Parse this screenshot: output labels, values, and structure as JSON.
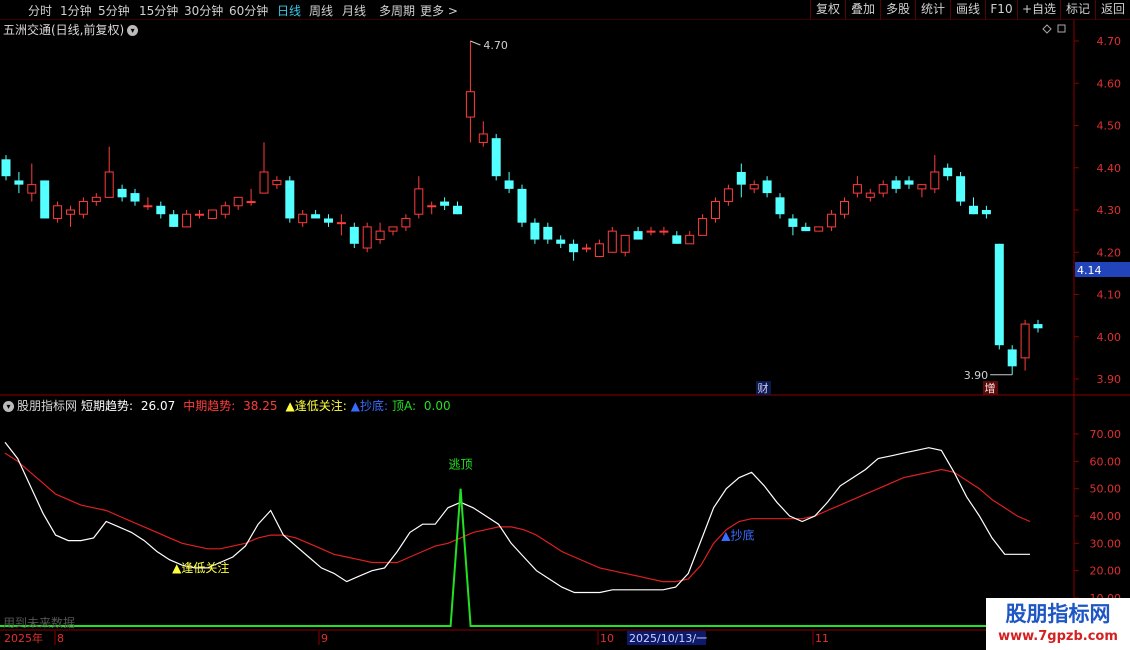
{
  "toolbar": {
    "periods": [
      "分时",
      "1分钟",
      "5分钟",
      "15分钟",
      "30分钟",
      "60分钟",
      "日线",
      "周线",
      "月线",
      "多周期",
      "更多"
    ],
    "active_period": "日线",
    "more_arrow": ">",
    "right_buttons": [
      "复权",
      "叠加",
      "多股",
      "统计",
      "画线",
      "F10",
      "+自选",
      "标记",
      "返回"
    ]
  },
  "main_chart": {
    "title": "五洲交通(日线,前复权)",
    "title_button_icon": "chevron-down-icon",
    "high_label": "4.70",
    "low_label": "3.90",
    "current_price": "4.14",
    "badge_cai": "财",
    "badge_zeng": "增",
    "price_ticks": [
      "4.70",
      "4.60",
      "4.50",
      "4.40",
      "4.30",
      "4.20",
      "4.10",
      "4.00",
      "3.90"
    ],
    "icons": [
      "diamond-icon",
      "square-icon"
    ]
  },
  "indicator": {
    "name": "股朋指标网",
    "short_label": "短期趋势:",
    "short_value": "26.07",
    "mid_label": "中期趋势:",
    "mid_value": "38.25",
    "low_focus_label": "▲逢低关注:",
    "bottom_label": "▲抄底:",
    "top_label": "顶A:",
    "top_value": "0.00",
    "ticks": [
      "70.00",
      "60.00",
      "50.00",
      "40.00",
      "30.00",
      "20.00",
      "10.00"
    ],
    "annotations": {
      "escape_top": "逃顶",
      "low_focus": "▲逢低关注",
      "buy_bottom": "▲抄底"
    },
    "future_note": "用到未来数据"
  },
  "date_axis": {
    "year": "2025年",
    "months": [
      "8",
      "9",
      "10",
      "11"
    ],
    "cursor_date": "2025/10/13/一"
  },
  "watermark": {
    "title": "股朋指标网",
    "url": "www.7gpzb.com"
  },
  "colors": {
    "up": "#ff3c3c",
    "down": "#54ffff",
    "short_line": "#ffffff",
    "mid_line": "#e02020",
    "signal_line": "#22e022",
    "axis": "#8b0000"
  },
  "chart_data": [
    {
      "type": "candlestick",
      "title": "五洲交通(日线,前复权)",
      "y_ticks": [
        3.9,
        4.0,
        4.1,
        4.2,
        4.3,
        4.4,
        4.5,
        4.6,
        4.7
      ],
      "ylim": [
        3.87,
        4.74
      ],
      "candles": [
        {
          "o": 4.42,
          "h": 4.43,
          "l": 4.37,
          "c": 4.38
        },
        {
          "o": 4.37,
          "h": 4.39,
          "l": 4.34,
          "c": 4.36
        },
        {
          "o": 4.34,
          "h": 4.41,
          "l": 4.32,
          "c": 4.36
        },
        {
          "o": 4.37,
          "h": 4.37,
          "l": 4.28,
          "c": 4.28
        },
        {
          "o": 4.28,
          "h": 4.32,
          "l": 4.27,
          "c": 4.31
        },
        {
          "o": 4.29,
          "h": 4.31,
          "l": 4.26,
          "c": 4.3
        },
        {
          "o": 4.29,
          "h": 4.33,
          "l": 4.28,
          "c": 4.32
        },
        {
          "o": 4.32,
          "h": 4.34,
          "l": 4.31,
          "c": 4.33
        },
        {
          "o": 4.33,
          "h": 4.45,
          "l": 4.33,
          "c": 4.39
        },
        {
          "o": 4.35,
          "h": 4.36,
          "l": 4.32,
          "c": 4.33
        },
        {
          "o": 4.34,
          "h": 4.35,
          "l": 4.31,
          "c": 4.32
        },
        {
          "o": 4.31,
          "h": 4.33,
          "l": 4.3,
          "c": 4.31
        },
        {
          "o": 4.31,
          "h": 4.32,
          "l": 4.28,
          "c": 4.29
        },
        {
          "o": 4.29,
          "h": 4.3,
          "l": 4.26,
          "c": 4.26
        },
        {
          "o": 4.26,
          "h": 4.3,
          "l": 4.26,
          "c": 4.29
        },
        {
          "o": 4.29,
          "h": 4.3,
          "l": 4.28,
          "c": 4.29
        },
        {
          "o": 4.28,
          "h": 4.3,
          "l": 4.28,
          "c": 4.3
        },
        {
          "o": 4.29,
          "h": 4.32,
          "l": 4.28,
          "c": 4.31
        },
        {
          "o": 4.31,
          "h": 4.33,
          "l": 4.3,
          "c": 4.33
        },
        {
          "o": 4.32,
          "h": 4.35,
          "l": 4.31,
          "c": 4.32
        },
        {
          "o": 4.34,
          "h": 4.46,
          "l": 4.34,
          "c": 4.39
        },
        {
          "o": 4.36,
          "h": 4.38,
          "l": 4.35,
          "c": 4.37
        },
        {
          "o": 4.37,
          "h": 4.38,
          "l": 4.27,
          "c": 4.28
        },
        {
          "o": 4.27,
          "h": 4.3,
          "l": 4.26,
          "c": 4.29
        },
        {
          "o": 4.29,
          "h": 4.3,
          "l": 4.28,
          "c": 4.28
        },
        {
          "o": 4.28,
          "h": 4.29,
          "l": 4.26,
          "c": 4.27
        },
        {
          "o": 4.27,
          "h": 4.29,
          "l": 4.24,
          "c": 4.27
        },
        {
          "o": 4.26,
          "h": 4.27,
          "l": 4.21,
          "c": 4.22
        },
        {
          "o": 4.21,
          "h": 4.27,
          "l": 4.2,
          "c": 4.26
        },
        {
          "o": 4.23,
          "h": 4.27,
          "l": 4.22,
          "c": 4.25
        },
        {
          "o": 4.25,
          "h": 4.26,
          "l": 4.24,
          "c": 4.26
        },
        {
          "o": 4.26,
          "h": 4.29,
          "l": 4.25,
          "c": 4.28
        },
        {
          "o": 4.29,
          "h": 4.38,
          "l": 4.28,
          "c": 4.35
        },
        {
          "o": 4.31,
          "h": 4.32,
          "l": 4.29,
          "c": 4.31
        },
        {
          "o": 4.32,
          "h": 4.33,
          "l": 4.3,
          "c": 4.31
        },
        {
          "o": 4.31,
          "h": 4.32,
          "l": 4.29,
          "c": 4.29
        },
        {
          "o": 4.52,
          "h": 4.7,
          "l": 4.46,
          "c": 4.58
        },
        {
          "o": 4.46,
          "h": 4.51,
          "l": 4.45,
          "c": 4.48
        },
        {
          "o": 4.47,
          "h": 4.48,
          "l": 4.37,
          "c": 4.38
        },
        {
          "o": 4.37,
          "h": 4.39,
          "l": 4.34,
          "c": 4.35
        },
        {
          "o": 4.35,
          "h": 4.36,
          "l": 4.26,
          "c": 4.27
        },
        {
          "o": 4.27,
          "h": 4.28,
          "l": 4.22,
          "c": 4.23
        },
        {
          "o": 4.26,
          "h": 4.27,
          "l": 4.22,
          "c": 4.23
        },
        {
          "o": 4.23,
          "h": 4.24,
          "l": 4.21,
          "c": 4.22
        },
        {
          "o": 4.22,
          "h": 4.23,
          "l": 4.18,
          "c": 4.2
        },
        {
          "o": 4.21,
          "h": 4.22,
          "l": 4.2,
          "c": 4.21
        },
        {
          "o": 4.19,
          "h": 4.23,
          "l": 4.19,
          "c": 4.22
        },
        {
          "o": 4.2,
          "h": 4.26,
          "l": 4.2,
          "c": 4.25
        },
        {
          "o": 4.2,
          "h": 4.24,
          "l": 4.19,
          "c": 4.24
        },
        {
          "o": 4.25,
          "h": 4.26,
          "l": 4.23,
          "c": 4.23
        },
        {
          "o": 4.25,
          "h": 4.26,
          "l": 4.24,
          "c": 4.25
        },
        {
          "o": 4.25,
          "h": 4.26,
          "l": 4.24,
          "c": 4.25
        },
        {
          "o": 4.24,
          "h": 4.25,
          "l": 4.22,
          "c": 4.22
        },
        {
          "o": 4.22,
          "h": 4.25,
          "l": 4.22,
          "c": 4.24
        },
        {
          "o": 4.24,
          "h": 4.29,
          "l": 4.24,
          "c": 4.28
        },
        {
          "o": 4.28,
          "h": 4.33,
          "l": 4.27,
          "c": 4.32
        },
        {
          "o": 4.32,
          "h": 4.36,
          "l": 4.31,
          "c": 4.35
        },
        {
          "o": 4.39,
          "h": 4.41,
          "l": 4.33,
          "c": 4.36
        },
        {
          "o": 4.35,
          "h": 4.37,
          "l": 4.34,
          "c": 4.36
        },
        {
          "o": 4.37,
          "h": 4.38,
          "l": 4.33,
          "c": 4.34
        },
        {
          "o": 4.33,
          "h": 4.34,
          "l": 4.28,
          "c": 4.29
        },
        {
          "o": 4.28,
          "h": 4.29,
          "l": 4.24,
          "c": 4.26
        },
        {
          "o": 4.26,
          "h": 4.27,
          "l": 4.25,
          "c": 4.25
        },
        {
          "o": 4.25,
          "h": 4.26,
          "l": 4.25,
          "c": 4.26
        },
        {
          "o": 4.26,
          "h": 4.3,
          "l": 4.25,
          "c": 4.29
        },
        {
          "o": 4.29,
          "h": 4.33,
          "l": 4.28,
          "c": 4.32
        },
        {
          "o": 4.34,
          "h": 4.38,
          "l": 4.33,
          "c": 4.36
        },
        {
          "o": 4.33,
          "h": 4.35,
          "l": 4.32,
          "c": 4.34
        },
        {
          "o": 4.34,
          "h": 4.37,
          "l": 4.33,
          "c": 4.36
        },
        {
          "o": 4.37,
          "h": 4.38,
          "l": 4.34,
          "c": 4.35
        },
        {
          "o": 4.37,
          "h": 4.38,
          "l": 4.35,
          "c": 4.36
        },
        {
          "o": 4.35,
          "h": 4.36,
          "l": 4.33,
          "c": 4.36
        },
        {
          "o": 4.35,
          "h": 4.43,
          "l": 4.34,
          "c": 4.39
        },
        {
          "o": 4.4,
          "h": 4.41,
          "l": 4.37,
          "c": 4.38
        },
        {
          "o": 4.38,
          "h": 4.39,
          "l": 4.31,
          "c": 4.32
        },
        {
          "o": 4.31,
          "h": 4.33,
          "l": 4.29,
          "c": 4.29
        },
        {
          "o": 4.3,
          "h": 4.31,
          "l": 4.28,
          "c": 4.29
        },
        {
          "o": 4.22,
          "h": 4.22,
          "l": 3.97,
          "c": 3.98
        },
        {
          "o": 3.97,
          "h": 3.98,
          "l": 3.91,
          "c": 3.93
        },
        {
          "o": 3.95,
          "h": 4.04,
          "l": 3.92,
          "c": 4.03
        },
        {
          "o": 4.03,
          "h": 4.04,
          "l": 4.01,
          "c": 4.02
        }
      ]
    },
    {
      "type": "line",
      "title": "股朋指标网",
      "ylim": [
        0,
        80
      ],
      "y_ticks": [
        10,
        20,
        30,
        40,
        50,
        60,
        70
      ],
      "series": [
        {
          "name": "短期趋势",
          "values": [
            67,
            61,
            51,
            41,
            33,
            31,
            31,
            32,
            38,
            36,
            34,
            31,
            27,
            24,
            22,
            21,
            21,
            23,
            25,
            29,
            37,
            42,
            33,
            29,
            25,
            21,
            19,
            16,
            18,
            20,
            21,
            27,
            34,
            37,
            37,
            43,
            45,
            43,
            40,
            37,
            30,
            25,
            20,
            17,
            14,
            12,
            12,
            12,
            13,
            13,
            13,
            13,
            13,
            14,
            19,
            31,
            43,
            50,
            54,
            56,
            51,
            45,
            40,
            38,
            40,
            45,
            51,
            54,
            57,
            61,
            62,
            63,
            64,
            65,
            64,
            56,
            47,
            40,
            32,
            26,
            26,
            26
          ]
        },
        {
          "name": "中期趋势",
          "values": [
            63,
            60,
            56,
            52,
            48,
            46,
            44,
            43,
            42,
            40,
            38,
            36,
            34,
            32,
            30,
            29,
            28,
            28,
            29,
            30,
            32,
            33,
            33,
            32,
            30,
            28,
            26,
            25,
            24,
            23,
            23,
            23,
            25,
            27,
            29,
            30,
            32,
            34,
            35,
            36,
            36,
            35,
            33,
            30,
            27,
            25,
            23,
            21,
            20,
            19,
            18,
            17,
            16,
            16,
            17,
            22,
            30,
            35,
            38,
            39,
            39,
            39,
            39,
            39,
            40,
            42,
            44,
            46,
            48,
            50,
            52,
            54,
            55,
            56,
            57,
            56,
            53,
            50,
            46,
            43,
            40,
            38
          ]
        },
        {
          "name": "顶A",
          "values": [
            0,
            0,
            0,
            0,
            0,
            0,
            0,
            0,
            0,
            0,
            0,
            0,
            0,
            0,
            0,
            0,
            0,
            0,
            0,
            0,
            0,
            0,
            0,
            0,
            0,
            0,
            0,
            0,
            0,
            0,
            0,
            0,
            0,
            0,
            0,
            0,
            50,
            0,
            0,
            0,
            0,
            0,
            0,
            0,
            0,
            0,
            0,
            0,
            0,
            0,
            0,
            0,
            0,
            0,
            0,
            0,
            0,
            0,
            0,
            0,
            0,
            0,
            0,
            0,
            0,
            0,
            0,
            0,
            0,
            0,
            0,
            0,
            0,
            0,
            0,
            0,
            0,
            0,
            0,
            0,
            0,
            0
          ]
        }
      ],
      "signals": [
        {
          "label": "逃顶",
          "index": 36
        },
        {
          "label": "▲逢低关注",
          "index": 14
        },
        {
          "label": "▲抄底",
          "index": 57
        }
      ]
    }
  ]
}
